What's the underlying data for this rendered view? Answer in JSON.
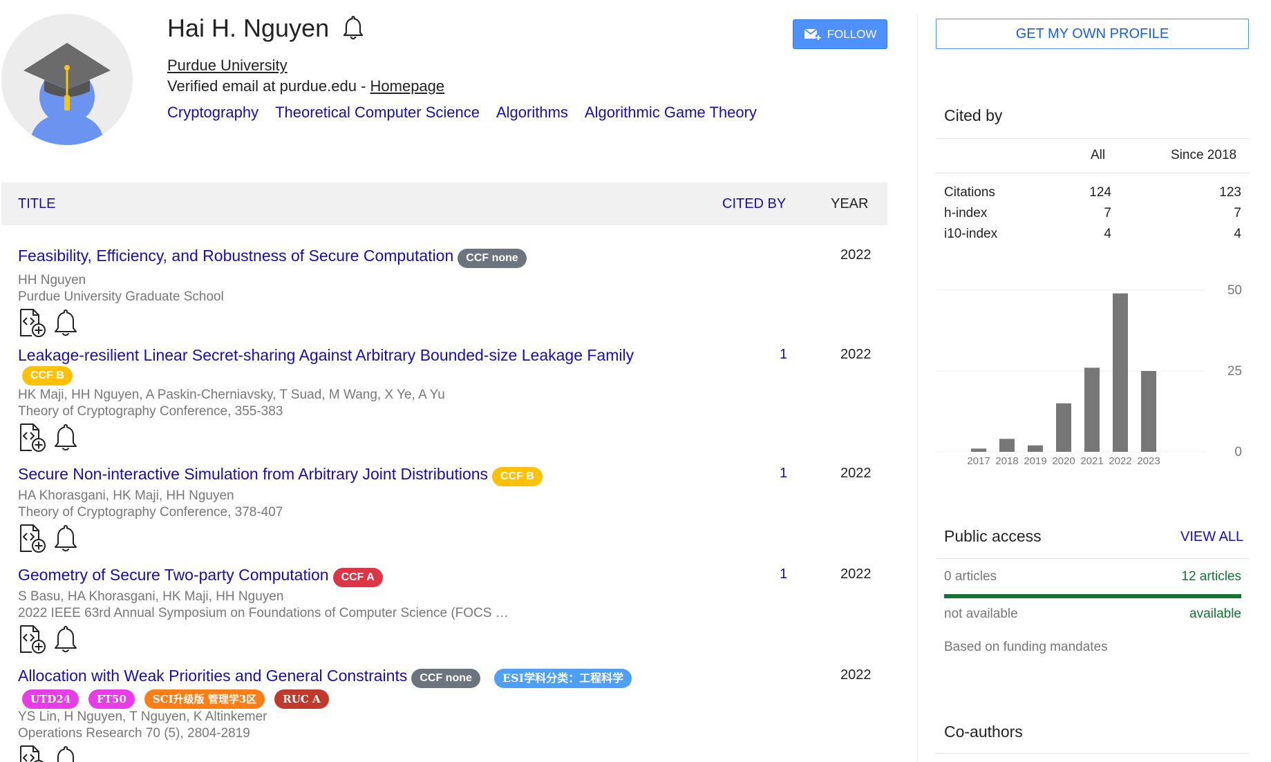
{
  "profile": {
    "name": "Hai H. Nguyen",
    "affiliation": "Purdue University",
    "email_text": "Verified email at purdue.edu - ",
    "homepage_label": "Homepage",
    "interests": [
      "Cryptography",
      "Theoretical Computer Science",
      "Algorithms",
      "Algorithmic Game Theory"
    ],
    "follow_label": "FOLLOW"
  },
  "table": {
    "col_title": "TITLE",
    "col_cited": "CITED BY",
    "col_year": "YEAR",
    "rows": [
      {
        "title": "Feasibility, Efficiency, and Robustness of Secure Computation",
        "badges": [
          {
            "text": "CCF none",
            "color": "#6c757d"
          }
        ],
        "authors": "HH Nguyen",
        "venue": "Purdue University Graduate School",
        "cited": "",
        "year": "2022"
      },
      {
        "title": "Leakage-resilient Linear Secret-sharing Against Arbitrary Bounded-size Leakage Family",
        "badges": [
          {
            "text": "CCF B",
            "color": "#ffc107"
          }
        ],
        "authors": "HK Maji, HH Nguyen, A Paskin-Cherniavsky, T Suad, M Wang, X Ye, A Yu",
        "venue": "Theory of Cryptography Conference, 355-383",
        "cited": "1",
        "year": "2022"
      },
      {
        "title": "Secure Non-interactive Simulation from Arbitrary Joint Distributions",
        "badges": [
          {
            "text": "CCF B",
            "color": "#ffc107"
          }
        ],
        "authors": "HA Khorasgani, HK Maji, HH Nguyen",
        "venue": "Theory of Cryptography Conference, 378-407",
        "cited": "1",
        "year": "2022"
      },
      {
        "title": "Geometry of Secure Two-party Computation",
        "badges": [
          {
            "text": "CCF A",
            "color": "#dc3545"
          }
        ],
        "authors": "S Basu, HA Khorasgani, HK Maji, HH Nguyen",
        "venue": "2022 IEEE 63rd Annual Symposium on Foundations of Computer Science (FOCS …",
        "cited": "1",
        "year": "2022"
      },
      {
        "title": "Allocation with Weak Priorities and General Constraints",
        "badges": [
          {
            "text": "CCF none",
            "color": "#6c757d"
          },
          {
            "text": "ESI学科分类：工程科学",
            "color": "#4d9ff7"
          }
        ],
        "badges2": [
          {
            "text": "UTD24",
            "color": "#e83ce6"
          },
          {
            "text": "FT50",
            "color": "#e83ce6"
          },
          {
            "text": "SCI升级版 管理学3区",
            "color": "#fd7e14"
          },
          {
            "text": "RUC A",
            "color": "#c0392b"
          }
        ],
        "authors": "YS Lin, H Nguyen, T Nguyen, K Altinkemer",
        "venue": "Operations Research 70 (5), 2804-2819",
        "cited": "",
        "year": "2022"
      }
    ]
  },
  "sidebar": {
    "own_profile_label": "GET MY OWN PROFILE",
    "cited_by_title": "Cited by",
    "col_all": "All",
    "col_since": "Since 2018",
    "metrics": [
      {
        "label": "Citations",
        "all": "124",
        "since": "123"
      },
      {
        "label": "h-index",
        "all": "7",
        "since": "7"
      },
      {
        "label": "i10-index",
        "all": "4",
        "since": "4"
      }
    ],
    "public_access_title": "Public access",
    "view_all_label": "VIEW ALL",
    "pa_left_count": "0 articles",
    "pa_right_count": "12 articles",
    "pa_left_status": "not available",
    "pa_right_status": "available",
    "pa_available_fraction": 1.0,
    "pa_note": "Based on funding mandates",
    "coauthors_title": "Co-authors"
  },
  "chart_data": {
    "type": "bar",
    "categories": [
      "2017",
      "2018",
      "2019",
      "2020",
      "2021",
      "2022",
      "2023"
    ],
    "values": [
      1,
      4,
      2,
      15,
      26,
      49,
      25
    ],
    "yticks": [
      0,
      25,
      50
    ],
    "ylim": [
      0,
      50
    ],
    "bar_color": "#777777"
  }
}
